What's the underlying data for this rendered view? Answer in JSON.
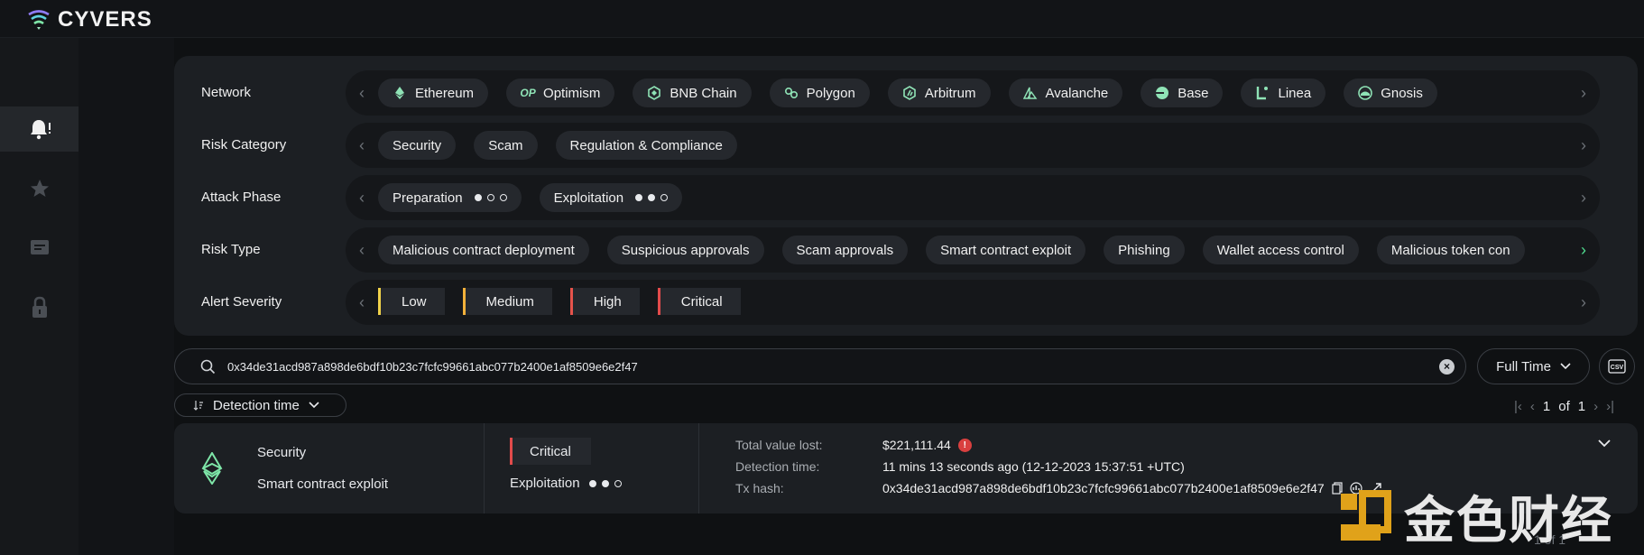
{
  "app": {
    "name": "CYVERS"
  },
  "sidebar": {
    "items": [
      {
        "icon": "bell-alert-icon",
        "active": true
      },
      {
        "icon": "star-icon",
        "active": false
      },
      {
        "icon": "message-icon",
        "active": false
      },
      {
        "icon": "lock-icon",
        "active": false
      }
    ]
  },
  "filters": {
    "network": {
      "label": "Network",
      "count": "9",
      "chips": [
        {
          "label": "Ethereum",
          "icon": "ethereum-icon"
        },
        {
          "label": "Optimism",
          "icon": "optimism-icon",
          "glyph": "OP"
        },
        {
          "label": "BNB Chain",
          "icon": "bnb-chain-icon"
        },
        {
          "label": "Polygon",
          "icon": "polygon-icon"
        },
        {
          "label": "Arbitrum",
          "icon": "arbitrum-icon"
        },
        {
          "label": "Avalanche",
          "icon": "avalanche-icon"
        },
        {
          "label": "Base",
          "icon": "base-icon"
        },
        {
          "label": "Linea",
          "icon": "linea-icon"
        },
        {
          "label": "Gnosis",
          "icon": "gnosis-icon"
        }
      ]
    },
    "risk_category": {
      "label": "Risk Category",
      "count": "3",
      "chips": [
        "Security",
        "Scam",
        "Regulation & Compliance"
      ]
    },
    "attack_phase": {
      "label": "Attack Phase",
      "count": "2",
      "chips": [
        {
          "label": "Preparation",
          "level": 1
        },
        {
          "label": "Exploitation",
          "level": 2
        }
      ]
    },
    "risk_type": {
      "label": "Risk Type",
      "count": "14",
      "chips": [
        "Malicious contract deployment",
        "Suspicious approvals",
        "Scam approvals",
        "Smart contract exploit",
        "Phishing",
        "Wallet access control",
        "Malicious token con"
      ]
    },
    "alert_severity": {
      "label": "Alert Severity",
      "count": "4",
      "chips": [
        {
          "label": "Low",
          "color": "#f0d24a"
        },
        {
          "label": "Medium",
          "color": "#f2b13a"
        },
        {
          "label": "High",
          "color": "#e5534b"
        },
        {
          "label": "Critical",
          "color": "#e24b4b"
        }
      ]
    }
  },
  "search": {
    "value": "0x34de31acd987a898de6bdf10b23c7fcfc99661abc077b2400e1af8509e6e2f47"
  },
  "time_filter": {
    "label": "Full Time"
  },
  "csv": {
    "label": "CSV"
  },
  "sort": {
    "label": "Detection time"
  },
  "pagination": {
    "current": "1",
    "of": "of",
    "total": "1"
  },
  "alert": {
    "category": "Security",
    "type": "Smart contract exploit",
    "severity": "Critical",
    "phase": "Exploitation",
    "phase_level": 2,
    "labels": {
      "value_lost": "Total value lost:",
      "detection_time": "Detection time:",
      "tx_hash": "Tx hash:"
    },
    "value_lost": "$221,111.44",
    "detection_time": "11 mins 13 seconds ago (12-12-2023 15:37:51 +UTC)",
    "tx_hash": "0x34de31acd987a898de6bdf10b23c7fcfc99661abc077b2400e1af8509e6e2f47"
  },
  "watermark": {
    "text": "金色财经"
  },
  "footer_pager": {
    "text": "1 of 1"
  }
}
